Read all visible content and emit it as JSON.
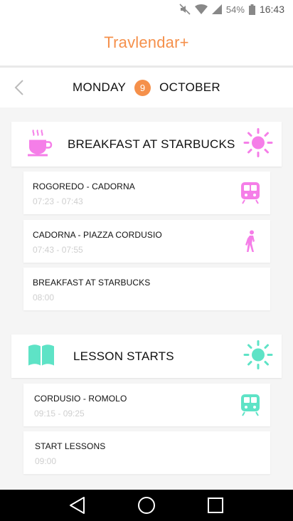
{
  "status_bar": {
    "battery": "54%",
    "time": "16:43"
  },
  "app": {
    "title": "Travlendar+"
  },
  "date": {
    "day_name": "MONDAY",
    "day_number": "9",
    "month": "OCTOBER"
  },
  "colors": {
    "accent": "#f5904b",
    "pink": "#f57ee8",
    "teal": "#5ee3c6"
  },
  "events": [
    {
      "title": "BREAKFAST AT STARBUCKS",
      "icon": "coffee-cup-icon",
      "weather_icon": "sun-icon",
      "steps": [
        {
          "title": "ROGOREDO - CADORNA",
          "time": "07:23 - 07:43",
          "icon": "train-icon"
        },
        {
          "title": "CADORNA - PIAZZA CORDUSIO",
          "time": "07:43 - 07:55",
          "icon": "walking-icon"
        },
        {
          "title": "BREAKFAST AT STARBUCKS",
          "time": "08:00",
          "icon": ""
        }
      ]
    },
    {
      "title": "LESSON STARTS",
      "icon": "book-icon",
      "weather_icon": "sun-icon",
      "steps": [
        {
          "title": "CORDUSIO - ROMOLO",
          "time": "09:15 - 09:25",
          "icon": "train-icon"
        },
        {
          "title": "START LESSONS",
          "time": "09:00",
          "icon": ""
        }
      ]
    }
  ]
}
